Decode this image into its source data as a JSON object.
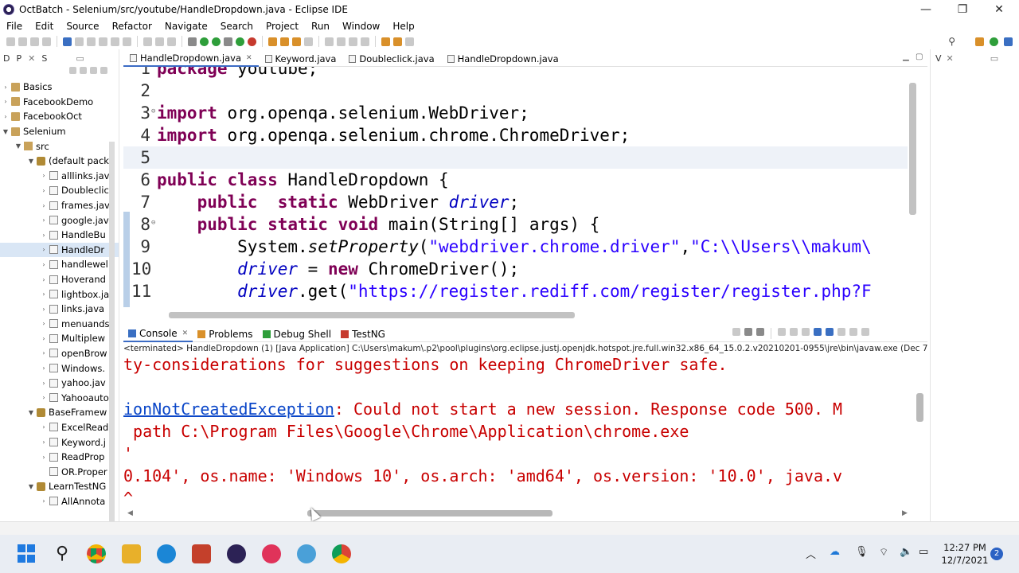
{
  "window": {
    "title": "OctBatch - Selenium/src/youtube/HandleDropdown.java - Eclipse IDE",
    "minimize": "—",
    "maximize": "❐",
    "close": "✕"
  },
  "menu": [
    "File",
    "Edit",
    "Source",
    "Refactor",
    "Navigate",
    "Search",
    "Project",
    "Run",
    "Window",
    "Help"
  ],
  "left_panel": {
    "tabs": [
      "D",
      "P",
      "S"
    ],
    "tree": [
      {
        "indent": 0,
        "chev": ">",
        "icon": "proj",
        "label": "Basics"
      },
      {
        "indent": 0,
        "chev": ">",
        "icon": "proj",
        "label": "FacebookDemo"
      },
      {
        "indent": 0,
        "chev": ">",
        "icon": "proj",
        "label": "FacebookOct"
      },
      {
        "indent": 0,
        "chev": "v",
        "icon": "proj",
        "label": "Selenium"
      },
      {
        "indent": 1,
        "chev": "v",
        "icon": "folder",
        "label": "src"
      },
      {
        "indent": 2,
        "chev": "v",
        "icon": "pkg",
        "label": "(default pack"
      },
      {
        "indent": 3,
        "chev": ">",
        "icon": "java",
        "label": "alllinks.jav"
      },
      {
        "indent": 3,
        "chev": ">",
        "icon": "java",
        "label": "Doubleclic"
      },
      {
        "indent": 3,
        "chev": ">",
        "icon": "java",
        "label": "frames.jav"
      },
      {
        "indent": 3,
        "chev": ">",
        "icon": "java",
        "label": "google.jav"
      },
      {
        "indent": 3,
        "chev": ">",
        "icon": "java",
        "label": "HandleBu"
      },
      {
        "indent": 3,
        "chev": ">",
        "icon": "java",
        "label": "HandleDr",
        "selected": true
      },
      {
        "indent": 3,
        "chev": ">",
        "icon": "java",
        "label": "handlewel"
      },
      {
        "indent": 3,
        "chev": ">",
        "icon": "java",
        "label": "Hoverand"
      },
      {
        "indent": 3,
        "chev": ">",
        "icon": "java",
        "label": "lightbox.ja"
      },
      {
        "indent": 3,
        "chev": ">",
        "icon": "java",
        "label": "links.java"
      },
      {
        "indent": 3,
        "chev": ">",
        "icon": "java",
        "label": "menuands"
      },
      {
        "indent": 3,
        "chev": ">",
        "icon": "java",
        "label": "Multiplew"
      },
      {
        "indent": 3,
        "chev": ">",
        "icon": "java",
        "label": "openBrow"
      },
      {
        "indent": 3,
        "chev": ">",
        "icon": "java",
        "label": "Windows."
      },
      {
        "indent": 3,
        "chev": ">",
        "icon": "java",
        "label": "yahoo.jav"
      },
      {
        "indent": 3,
        "chev": ">",
        "icon": "java",
        "label": "Yahooauto"
      },
      {
        "indent": 2,
        "chev": "v",
        "icon": "pkg",
        "label": "BaseFramew"
      },
      {
        "indent": 3,
        "chev": ">",
        "icon": "java",
        "label": "ExcelRead"
      },
      {
        "indent": 3,
        "chev": ">",
        "icon": "java",
        "label": "Keyword.j"
      },
      {
        "indent": 3,
        "chev": ">",
        "icon": "java",
        "label": "ReadProp"
      },
      {
        "indent": 3,
        "chev": "",
        "icon": "java",
        "label": "OR.Proper"
      },
      {
        "indent": 2,
        "chev": "v",
        "icon": "pkg",
        "label": "LearnTestNG"
      },
      {
        "indent": 3,
        "chev": ">",
        "icon": "java",
        "label": "AllAnnota"
      }
    ]
  },
  "editor": {
    "tabs": [
      {
        "label": "HandleDropdown.java",
        "active": true,
        "closable": true
      },
      {
        "label": "Keyword.java",
        "active": false
      },
      {
        "label": "Doubleclick.java",
        "active": false
      },
      {
        "label": "HandleDropdown.java",
        "active": false
      }
    ],
    "lines": [
      {
        "num": "1",
        "fold": "",
        "parts": [
          [
            "kw",
            "package"
          ],
          [
            "",
            " youtube;"
          ]
        ]
      },
      {
        "num": "2",
        "fold": "",
        "parts": []
      },
      {
        "num": "3",
        "fold": "⊖",
        "parts": [
          [
            "kw",
            "import"
          ],
          [
            "",
            " org.openqa.selenium.WebDriver;"
          ]
        ]
      },
      {
        "num": "4",
        "fold": "",
        "parts": [
          [
            "kw",
            "import"
          ],
          [
            "",
            " org.openqa.selenium.chrome.ChromeDriver;"
          ]
        ]
      },
      {
        "num": "5",
        "fold": "",
        "parts": [],
        "highlight": true
      },
      {
        "num": "6",
        "fold": "",
        "parts": [
          [
            "kw",
            "public"
          ],
          [
            "",
            " "
          ],
          [
            "kw",
            "class"
          ],
          [
            "",
            " HandleDropdown {"
          ]
        ]
      },
      {
        "num": "7",
        "fold": "",
        "parts": [
          [
            "",
            "    "
          ],
          [
            "kw",
            "public"
          ],
          [
            "",
            "  "
          ],
          [
            "kw",
            "static"
          ],
          [
            "",
            " WebDriver "
          ],
          [
            "fld",
            "driver"
          ],
          [
            "",
            ";"
          ]
        ]
      },
      {
        "num": "8",
        "fold": "⊖",
        "parts": [
          [
            "",
            "    "
          ],
          [
            "kw",
            "public"
          ],
          [
            "",
            " "
          ],
          [
            "kw",
            "static"
          ],
          [
            "",
            " "
          ],
          [
            "kw",
            "void"
          ],
          [
            "",
            " main(String[] args) {"
          ]
        ]
      },
      {
        "num": "9",
        "fold": "",
        "parts": [
          [
            "",
            "        System."
          ],
          [
            "stat",
            "setProperty"
          ],
          [
            "",
            "("
          ],
          [
            "str",
            "\"webdriver.chrome.driver\""
          ],
          [
            "",
            ","
          ],
          [
            "str",
            "\"C:\\\\Users\\\\makum\\"
          ]
        ]
      },
      {
        "num": "10",
        "fold": "",
        "parts": [
          [
            "",
            "        "
          ],
          [
            "fld",
            "driver"
          ],
          [
            "",
            " = "
          ],
          [
            "kw",
            "new"
          ],
          [
            "",
            " ChromeDriver();"
          ]
        ]
      },
      {
        "num": "11",
        "fold": "",
        "parts": [
          [
            "",
            "        "
          ],
          [
            "fld",
            "driver"
          ],
          [
            "",
            ".get("
          ],
          [
            "str",
            "\"https://register.rediff.com/register/register.php?F"
          ]
        ]
      }
    ]
  },
  "right_panel": {
    "tabs": [
      "V",
      "✕"
    ]
  },
  "console": {
    "tabs": [
      {
        "label": "Console",
        "active": true,
        "closable": true
      },
      {
        "label": "Problems",
        "active": false
      },
      {
        "label": "Debug Shell",
        "active": false
      },
      {
        "label": "TestNG",
        "active": false
      }
    ],
    "status": "<terminated> HandleDropdown (1) [Java Application] C:\\Users\\makum\\.p2\\pool\\plugins\\org.eclipse.justj.openjdk.hotspot.jre.full.win32.x86_64_15.0.2.v20210201-0955\\jre\\bin\\javaw.exe  (Dec 7",
    "lines": [
      {
        "parts": [
          [
            "",
            "ty-considerations for suggestions on keeping ChromeDriver safe."
          ]
        ]
      },
      {
        "parts": []
      },
      {
        "parts": [
          [
            "link",
            "ionNotCreatedException"
          ],
          [
            "",
            ": Could not start a new session. Response code 500. M"
          ]
        ]
      },
      {
        "parts": [
          [
            "",
            " path C:\\Program Files\\Google\\Chrome\\Application\\chrome.exe"
          ]
        ]
      },
      {
        "parts": [
          [
            "",
            "'"
          ]
        ]
      },
      {
        "parts": [
          [
            "",
            "0.104', os.name: 'Windows 10', os.arch: 'amd64', os.version: '10.0', java.v"
          ]
        ]
      },
      {
        "parts": [
          [
            "",
            "^"
          ]
        ]
      }
    ]
  },
  "taskbar": {
    "time": "12:27 PM",
    "date": "12/7/2021",
    "notifications": "2"
  }
}
